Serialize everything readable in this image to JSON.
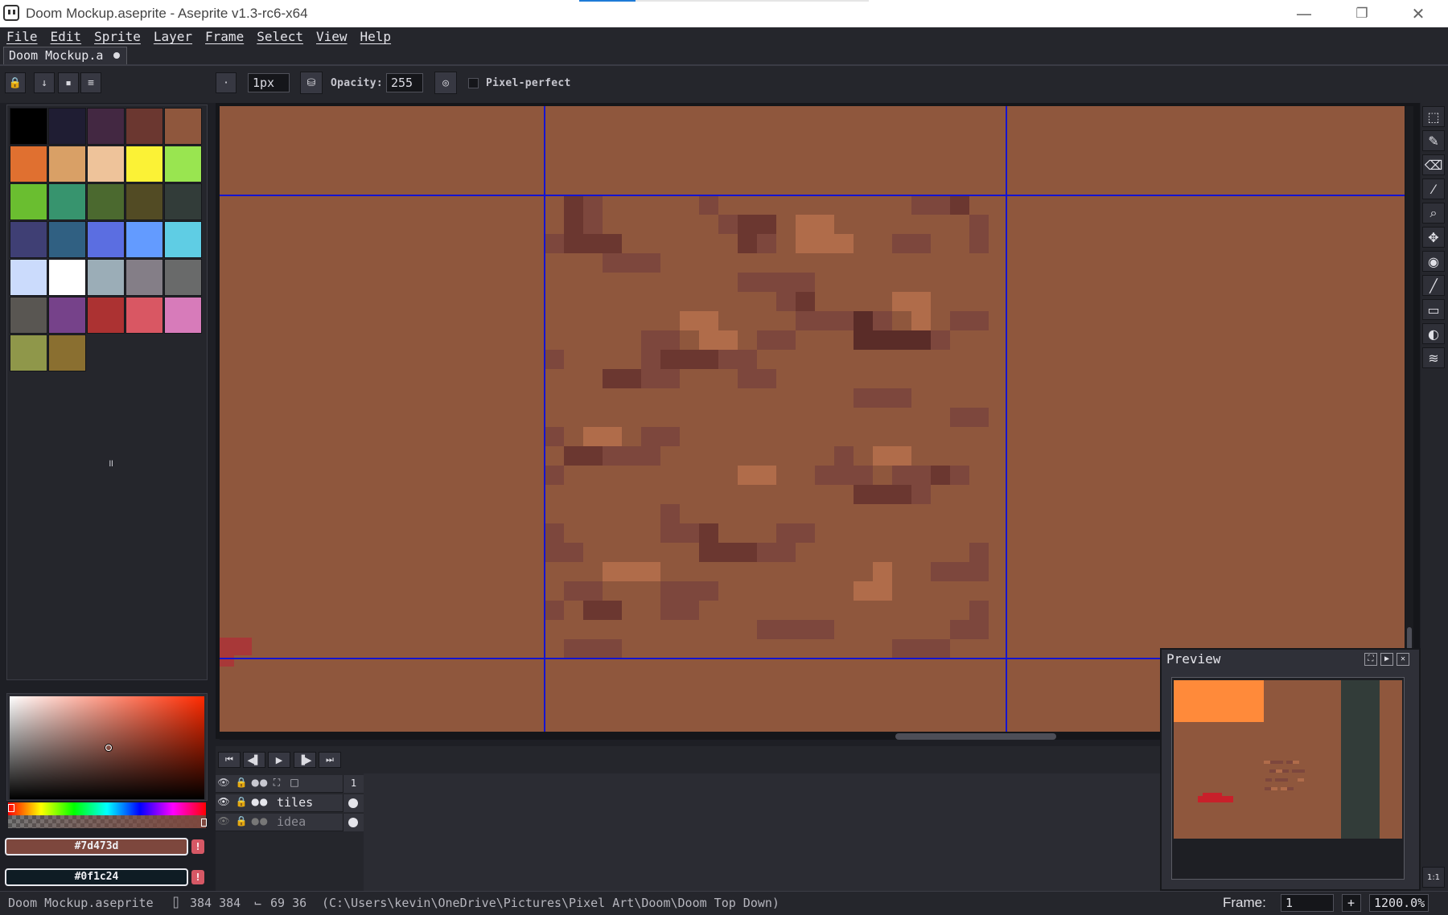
{
  "window": {
    "title": "Doom Mockup.aseprite - Aseprite v1.3-rc6-x64",
    "minimize": "—",
    "maximize": "❐",
    "close": "✕"
  },
  "menu": [
    "File",
    "Edit",
    "Sprite",
    "Layer",
    "Frame",
    "Select",
    "View",
    "Help"
  ],
  "tab": {
    "label": "Doom Mockup.a"
  },
  "toolbar": {
    "brush_size": "1px",
    "opacity_label": "Opacity:",
    "opacity_value": "255",
    "pixel_perfect_label": "Pixel-perfect"
  },
  "palette": [
    "#000000",
    "#1f1d33",
    "#432842",
    "#6b3730",
    "#8f573d",
    "#e07030",
    "#d9a066",
    "#eec39a",
    "#fbf236",
    "#99e550",
    "#6abe30",
    "#37946e",
    "#4b692f",
    "#524b24",
    "#323c39",
    "#3f3f74",
    "#306082",
    "#5b6ee1",
    "#639bff",
    "#5fcde4",
    "#cbdbfc",
    "#ffffff",
    "#9badb7",
    "#847e87",
    "#696a6a",
    "#595652",
    "#76428a",
    "#ac3232",
    "#d95763",
    "#d77bba",
    "#8f974a",
    "#8a6f30"
  ],
  "palette_grip": "॥",
  "colors": {
    "foreground_hex": "#7d473d",
    "background_hex": "#0f1c24",
    "warn_symbol": "!"
  },
  "canvas": {
    "bg_color": "#8f573d",
    "grid_color": "#1414d0",
    "tile_colors": {
      "dark": "#7d473d",
      "darker": "#6b3730",
      "darkest": "#5a2c28",
      "light": "#b06c4a"
    }
  },
  "tools": [
    {
      "name": "marquee-icon",
      "glyph": "⬚"
    },
    {
      "name": "pencil-icon",
      "glyph": "✎"
    },
    {
      "name": "eraser-icon",
      "glyph": "⌫"
    },
    {
      "name": "eyedropper-icon",
      "glyph": "⁄"
    },
    {
      "name": "zoom-icon",
      "glyph": "⌕"
    },
    {
      "name": "move-icon",
      "glyph": "✥"
    },
    {
      "name": "paint-bucket-icon",
      "glyph": "◉"
    },
    {
      "name": "line-icon",
      "glyph": "╱"
    },
    {
      "name": "rectangle-icon",
      "glyph": "▭"
    },
    {
      "name": "contour-icon",
      "glyph": "◐"
    },
    {
      "name": "blur-icon",
      "glyph": "≋"
    }
  ],
  "timeline": {
    "buttons": [
      "⏮",
      "◀▌",
      "▶",
      "▐▶",
      "⏭"
    ],
    "frame_header": "1",
    "layers": [
      {
        "name": "tiles",
        "visible": "👁",
        "lock": "🔒",
        "continuous": "●●"
      },
      {
        "name": "idea",
        "visible": "👁",
        "lock": "🔒",
        "continuous": "●●"
      }
    ]
  },
  "preview": {
    "title": "Preview",
    "buttons": [
      "⛶",
      "▶",
      "✕"
    ]
  },
  "status": {
    "filename": "Doom Mockup.aseprite",
    "size_icon": "⌷",
    "size": "384 384",
    "pos_icon": "⌙",
    "pos": "69 36",
    "path": "(C:\\Users\\kevin\\OneDrive\\Pictures\\Pixel Art\\Doom\\Doom Top Down)",
    "frame_label": "Frame:",
    "frame_value": "1",
    "add_frame": "+",
    "zoom": "1200.0%",
    "zoom_reset": "1:1"
  }
}
